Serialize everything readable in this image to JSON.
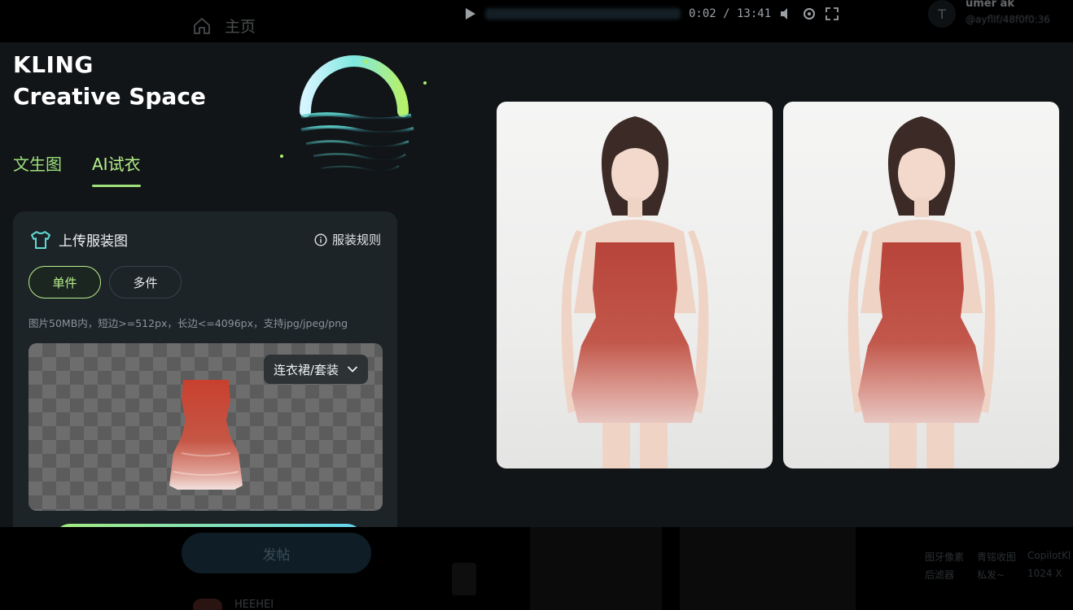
{
  "topbar": {
    "home_label": "主页",
    "player_time": "0:02 / 13:41",
    "user_initial": "T",
    "user_name": "umer ak",
    "user_id": "@ayfllf/48f0f0:36"
  },
  "brand": {
    "line1": "KLING",
    "line2": "Creative Space"
  },
  "tabs": [
    {
      "label": "文生图",
      "active": false
    },
    {
      "label": "AI试衣",
      "active": true
    }
  ],
  "upload_panel": {
    "title": "上传服装图",
    "rules_label": "服装规则",
    "segments": [
      {
        "label": "单件",
        "active": true
      },
      {
        "label": "多件",
        "active": false
      }
    ],
    "hint": "图片50MB内，短边>=512px，长边<=4096px，支持jpg/jpeg/png",
    "category_selected": "连衣裙/套装"
  },
  "bottombar": {
    "publish_label": "发帖",
    "author_name": "HEEHEI",
    "meta_1": "图牙像素",
    "meta_2": "青铭收图",
    "meta_3": "CopilotKl",
    "meta_4": "后滤器",
    "meta_5": "私发~",
    "meta_6": "1024 X"
  },
  "colors": {
    "accent_green": "#9ee07a",
    "panel_bg": "#1d2428",
    "surface_bg": "#111518",
    "dress_red": "#b8443a"
  }
}
